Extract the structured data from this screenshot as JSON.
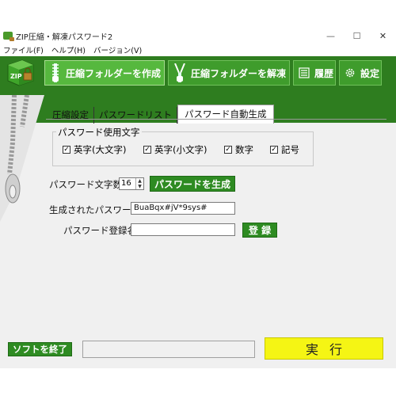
{
  "window": {
    "title": "ZIP圧縮・解凍パスワード2"
  },
  "titlebar_buttons": {
    "minimize": "—",
    "maximize": "☐",
    "close": "✕"
  },
  "menu": [
    "ファイル(F)",
    "ヘルプ(H)",
    "バージョン(V)"
  ],
  "toolbar": {
    "create_label": "圧縮フォルダーを作成",
    "extract_label": "圧縮フォルダーを解凍",
    "history_label": "履歴",
    "settings_label": "設定",
    "logo_text": "ZIP"
  },
  "tabs": [
    "圧縮設定",
    "パスワードリスト",
    "パスワード自動生成"
  ],
  "charset_group": {
    "legend": "パスワード使用文字",
    "options": [
      {
        "label": "英字(大文字)",
        "checked": true,
        "mark": "✓"
      },
      {
        "label": "英字(小文字)",
        "checked": true,
        "mark": "✓"
      },
      {
        "label": "数字",
        "checked": true,
        "mark": "✓"
      },
      {
        "label": "記号",
        "checked": true,
        "mark": "✓"
      }
    ]
  },
  "length": {
    "label": "パスワード文字数",
    "value": "16",
    "up": "▲",
    "down": "▼"
  },
  "generate_button": "パスワードを生成",
  "generated": {
    "label": "生成されたパスワード",
    "value": "BuaBqx#jV*9sys#"
  },
  "register": {
    "label": "パスワード登録名",
    "value": "",
    "button": "登 録"
  },
  "footer": {
    "exit_button": "ソフトを終了",
    "run_button": "実行"
  },
  "colors": {
    "toolbar": "#2e7d1f",
    "button_green": "#2e8b22",
    "run_yellow": "#f5f514"
  }
}
